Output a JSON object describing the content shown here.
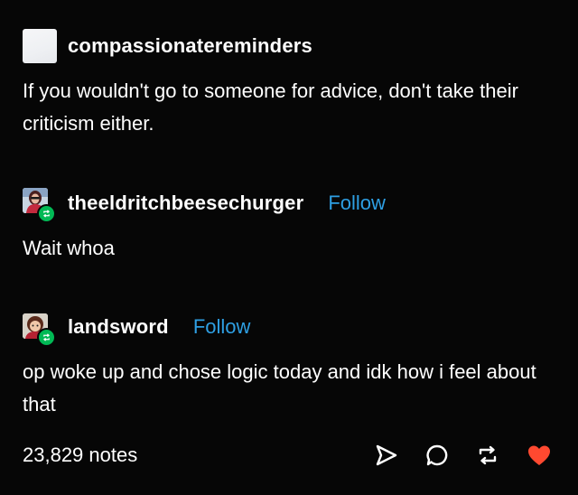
{
  "post": {
    "op": {
      "username": "compassionatereminders",
      "text": "If you wouldn't go to someone for advice, don't take their criticism either."
    },
    "reblogs": [
      {
        "username": "theeldritchbeesechurger",
        "follow_label": "Follow",
        "text": "Wait whoa"
      },
      {
        "username": "landsword",
        "follow_label": "Follow",
        "text": "op woke up and chose logic today and idk how i feel about that"
      }
    ],
    "notes": "23,829 notes"
  },
  "icons": {
    "share": "share-icon",
    "reply": "reply-icon",
    "reblog": "reblog-icon",
    "like": "heart-icon"
  },
  "colors": {
    "background": "#060606",
    "follow": "#2e9fe3",
    "like": "#ff4930",
    "reblog_badge": "#01b955"
  }
}
